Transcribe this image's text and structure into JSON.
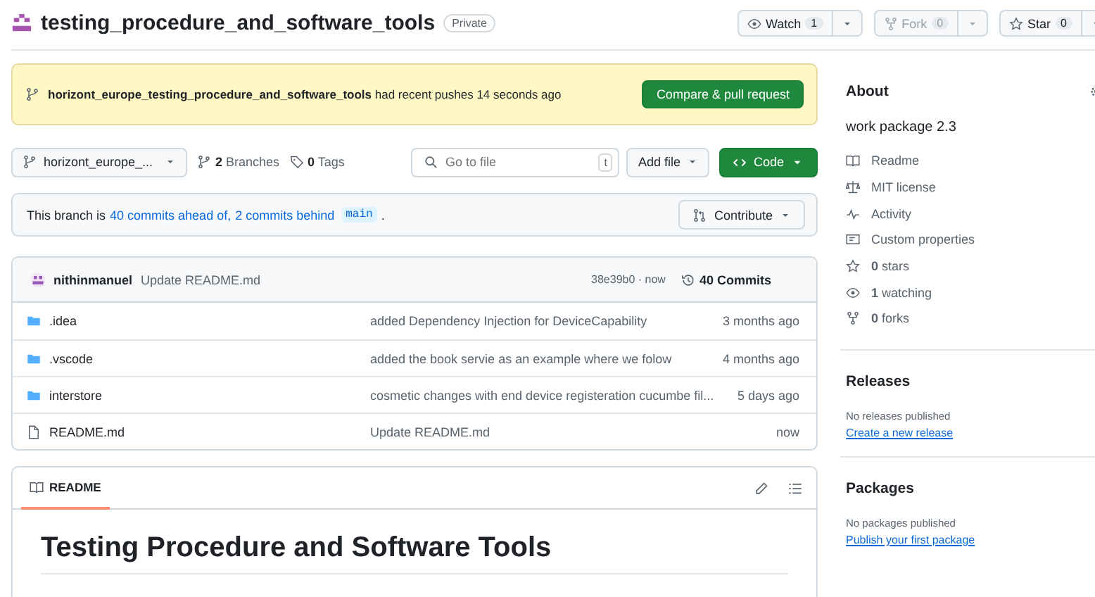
{
  "repo": {
    "name": "testing_procedure_and_software_tools",
    "visibility": "Private"
  },
  "header_buttons": [
    {
      "kind": "watch",
      "label": "Watch",
      "count": "1",
      "disabled": false
    },
    {
      "kind": "fork",
      "label": "Fork",
      "count": "0",
      "disabled": true
    },
    {
      "kind": "star",
      "label": "Star",
      "count": "0",
      "disabled": false
    }
  ],
  "push_banner": {
    "branch": "horizont_europe_testing_procedure_and_software_tools",
    "message": "had recent pushes 14 seconds ago",
    "button": "Compare & pull request"
  },
  "toolbar": {
    "branch": "horizont_europe_...",
    "branches": "**2** Branches",
    "tags": "**0** Tags",
    "search_placeholder": "Go to file",
    "search_key": "t",
    "add_file": "Add file",
    "code": "Code"
  },
  "branch_status": {
    "text_before": "This branch is",
    "ahead": "40 commits ahead of,",
    "behind": "2 commits behind",
    "base": "main",
    "text_after": ".",
    "contribute": "Contribute"
  },
  "latest_commit": {
    "author": "nithinmanuel",
    "message": "Update README.md",
    "sha_time": "38e39b0 · now",
    "commits": "40 Commits"
  },
  "files": [
    {
      "kind": "folder",
      "name": ".idea",
      "message": "added Dependency Injection for DeviceCapability",
      "time": "3 months ago"
    },
    {
      "kind": "folder",
      "name": ".vscode",
      "message": "added the book servie as an example where we folow",
      "time": "4 months ago"
    },
    {
      "kind": "folder",
      "name": "interstore",
      "message": "cosmetic changes with end device registeration cucumbe fil...",
      "time": "5 days ago"
    },
    {
      "kind": "file",
      "name": "README.md",
      "message": "Update README.md",
      "time": "now"
    }
  ],
  "readme": {
    "tab": "README",
    "heading": "Testing Procedure and Software Tools"
  },
  "about": {
    "title": "About",
    "description": "work package 2.3",
    "items": [
      {
        "kind": "book",
        "label": "Readme"
      },
      {
        "kind": "law",
        "label": "MIT license"
      },
      {
        "kind": "pulse",
        "label": "Activity"
      },
      {
        "kind": "note",
        "label": "Custom properties"
      },
      {
        "kind": "star",
        "label": "**0** stars"
      },
      {
        "kind": "eye",
        "label": "**1** watching"
      },
      {
        "kind": "fork",
        "label": "**0** forks"
      }
    ]
  },
  "releases": {
    "title": "Releases",
    "note": "No releases published",
    "link": "Create a new release"
  },
  "packages": {
    "title": "Packages",
    "note": "No packages published",
    "link": "Publish your first package"
  }
}
